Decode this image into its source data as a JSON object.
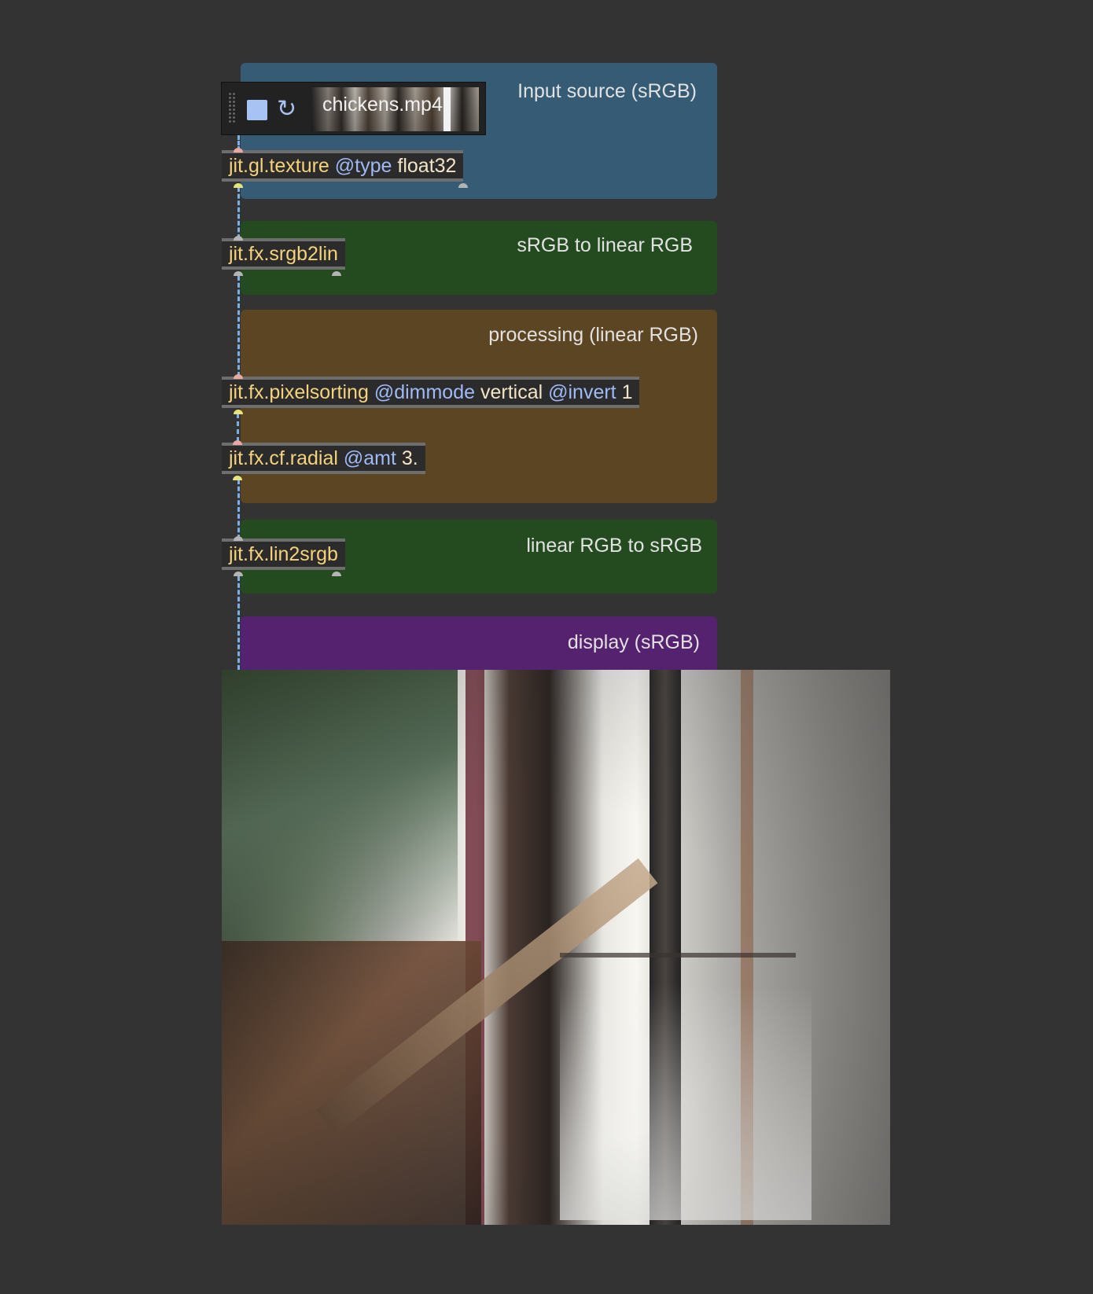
{
  "panels": {
    "input": "Input source (sRGB)",
    "srgb2lin": "sRGB to linear RGB",
    "processing": "processing (linear RGB)",
    "lin2srgb": "linear RGB to sRGB",
    "display": "display (sRGB)"
  },
  "player": {
    "filename": "chickens.mp4",
    "stop_icon": "stop-icon",
    "loop_icon": "loop-icon",
    "accent": "#a7c3f3"
  },
  "objects": {
    "texture": {
      "name": "jit.gl.texture",
      "attr": "@type",
      "value": "float32"
    },
    "srgb2lin": {
      "name": "jit.fx.srgb2lin"
    },
    "pixelsorting": {
      "name": "jit.fx.pixelsorting",
      "attr1": "@dimmode",
      "value1": "vertical",
      "attr2": "@invert",
      "value2": "1"
    },
    "radial": {
      "name": "jit.fx.cf.radial",
      "attr": "@amt",
      "value": "3."
    },
    "lin2srgb": {
      "name": "jit.fx.lin2srgb"
    }
  },
  "colors": {
    "background": "#333333",
    "input_panel": "#365b74",
    "green_panel": "#244a20",
    "processing_panel": "#5c4522",
    "display_panel": "#55226f",
    "object_name": "#f5d27c",
    "attribute": "#9fbaf6",
    "patchcord": "#7ab0e8"
  }
}
